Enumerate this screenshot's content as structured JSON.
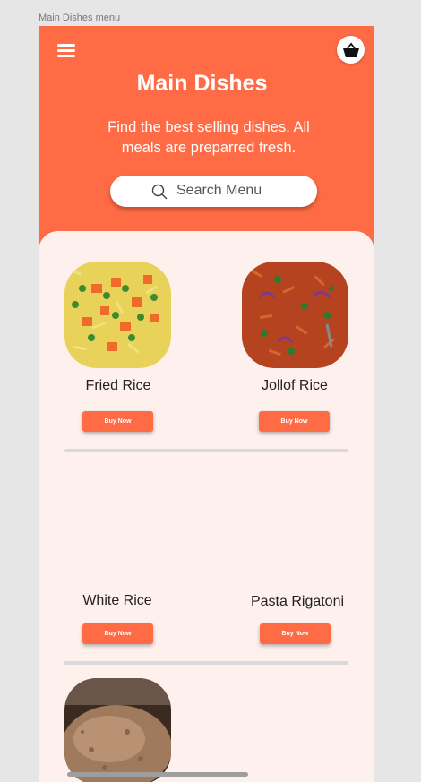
{
  "frame_label": "Main Dishes menu",
  "header": {
    "title": "Main Dishes",
    "subtitle": "Find the best selling dishes. All meals are preparred fresh.",
    "menu_icon": "hamburger-menu-icon",
    "cart_icon": "basket-icon"
  },
  "search": {
    "placeholder": "Search Menu",
    "icon": "search-icon"
  },
  "colors": {
    "accent": "#ff6b45",
    "content_bg": "#fdf0ed",
    "divider": "#d9d9d9"
  },
  "dishes": [
    {
      "name": "Fried Rice",
      "button": "Buy Now"
    },
    {
      "name": "Jollof Rice",
      "button": "Buy Now"
    },
    {
      "name": "White Rice",
      "button": "Buy Now"
    },
    {
      "name": "Pasta Rigatoni",
      "button": "Buy Now"
    },
    {
      "name": "",
      "button": ""
    }
  ]
}
